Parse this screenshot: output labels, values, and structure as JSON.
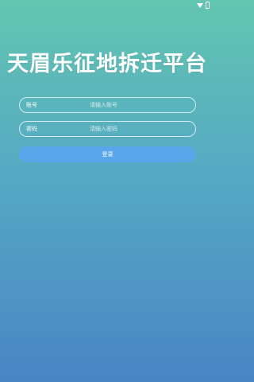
{
  "status_bar": {
    "icons": [
      "wifi-icon",
      "battery-icon"
    ]
  },
  "title": "天眉乐征地拆迁平台",
  "form": {
    "account": {
      "label": "账号",
      "placeholder": "请输入账号"
    },
    "password": {
      "label": "密码",
      "placeholder": "请输入密码"
    },
    "login_label": "登录"
  },
  "colors": {
    "gradient_top": "#62c6b0",
    "gradient_bottom": "#4a85c5",
    "button": "#5aa6ea"
  }
}
